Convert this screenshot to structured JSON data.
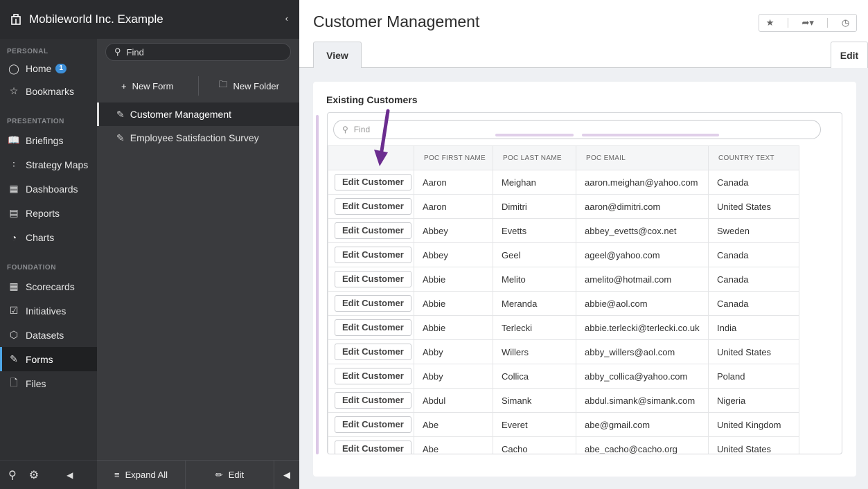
{
  "org": {
    "name": "Mobileworld Inc. Example",
    "collapse_icon": "chevron-left-icon"
  },
  "nav": {
    "sections": {
      "personal": "PERSONAL",
      "presentation": "PRESENTATION",
      "foundation": "FOUNDATION"
    },
    "items": [
      {
        "label": "Home",
        "icon": "person-icon",
        "badge": "1"
      },
      {
        "label": "Bookmarks",
        "icon": "star-outline-icon"
      },
      {
        "label": "Briefings",
        "icon": "book-icon"
      },
      {
        "label": "Strategy Maps",
        "icon": "strategy-map-icon"
      },
      {
        "label": "Dashboards",
        "icon": "dashboard-icon"
      },
      {
        "label": "Reports",
        "icon": "report-icon"
      },
      {
        "label": "Charts",
        "icon": "pie-chart-icon"
      },
      {
        "label": "Scorecards",
        "icon": "scorecard-icon"
      },
      {
        "label": "Initiatives",
        "icon": "checkbox-icon"
      },
      {
        "label": "Datasets",
        "icon": "cube-icon"
      },
      {
        "label": "Forms",
        "icon": "form-icon"
      },
      {
        "label": "Files",
        "icon": "files-icon"
      }
    ]
  },
  "middle": {
    "search_placeholder": "Find",
    "new_form": "New Form",
    "new_folder": "New Folder",
    "items": [
      "Customer Management",
      "Employee Satisfaction Survey"
    ],
    "expand_all": "Expand All",
    "edit": "Edit"
  },
  "main": {
    "title": "Customer Management",
    "tab_view": "View",
    "tab_edit": "Edit",
    "card_title": "Existing Customers",
    "grid_search_placeholder": "Find",
    "columns": [
      "",
      "POC FIRST NAME",
      "POC LAST NAME",
      "POC EMAIL",
      "COUNTRY TEXT"
    ],
    "edit_button_label": "Edit Customer",
    "rows": [
      {
        "first": "Aaron",
        "last": "Meighan",
        "email": "aaron.meighan@yahoo.com",
        "country": "Canada"
      },
      {
        "first": "Aaron",
        "last": "Dimitri",
        "email": "aaron@dimitri.com",
        "country": "United States"
      },
      {
        "first": "Abbey",
        "last": "Evetts",
        "email": "abbey_evetts@cox.net",
        "country": "Sweden"
      },
      {
        "first": "Abbey",
        "last": "Geel",
        "email": "ageel@yahoo.com",
        "country": "Canada"
      },
      {
        "first": "Abbie",
        "last": "Melito",
        "email": "amelito@hotmail.com",
        "country": "Canada"
      },
      {
        "first": "Abbie",
        "last": "Meranda",
        "email": "abbie@aol.com",
        "country": "Canada"
      },
      {
        "first": "Abbie",
        "last": "Terlecki",
        "email": "abbie.terlecki@terlecki.co.uk",
        "country": "India"
      },
      {
        "first": "Abby",
        "last": "Willers",
        "email": "abby_willers@aol.com",
        "country": "United States"
      },
      {
        "first": "Abby",
        "last": "Collica",
        "email": "abby_collica@yahoo.com",
        "country": "Poland"
      },
      {
        "first": "Abdul",
        "last": "Simank",
        "email": "abdul.simank@simank.com",
        "country": "Nigeria"
      },
      {
        "first": "Abe",
        "last": "Everet",
        "email": "abe@gmail.com",
        "country": "United Kingdom"
      },
      {
        "first": "Abe",
        "last": "Cacho",
        "email": "abe_cacho@cacho.org",
        "country": "United States"
      }
    ]
  },
  "colors": {
    "accent": "#3d8fd8",
    "annotation_arrow": "#6b2d8f",
    "nav_bg": "#2f3033"
  }
}
